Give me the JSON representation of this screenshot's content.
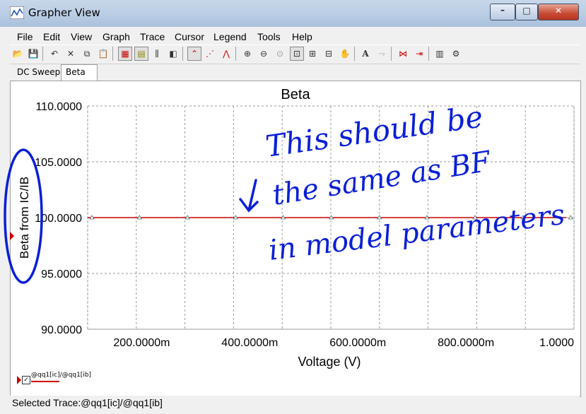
{
  "window": {
    "title": "Grapher View",
    "minimize": "–",
    "maximize": "□",
    "close": "✕"
  },
  "menu": [
    "File",
    "Edit",
    "View",
    "Graph",
    "Trace",
    "Cursor",
    "Legend",
    "Tools",
    "Help"
  ],
  "toolbar_icons": [
    "open-icon",
    "save-icon",
    "undo-icon",
    "cut-icon",
    "copy-icon",
    "paste-icon",
    "grid-icon",
    "fine-grid-icon",
    "legend-icon",
    "overlay-icon",
    "select-trace-icon",
    "show-points-icon",
    "marker-icon",
    "zoom-in-icon",
    "zoom-out-icon",
    "zoom-fit-icon",
    "zoom-region-icon",
    "zoom-x-icon",
    "zoom-y-icon",
    "pan-icon",
    "text-icon",
    "label-icon",
    "cursor-icon",
    "move-cursor-icon",
    "export-icon",
    "properties-icon"
  ],
  "tabs": [
    {
      "label": "DC Sweep",
      "active": false
    },
    {
      "label": "Beta",
      "active": true
    }
  ],
  "legend": {
    "trace_label": "@qq1[ic]/@qq1[ib]",
    "checkbox": "✓",
    "color": "#cc0000"
  },
  "status": {
    "text": "Selected Trace:@qq1[ic]/@qq1[ib]"
  },
  "annotation": {
    "lines": [
      "This should be",
      "the same as BF",
      "in model parameters"
    ],
    "color": "#0a1fd6"
  },
  "chart_data": {
    "type": "line",
    "title": "Beta",
    "xlabel": "Voltage (V)",
    "ylabel": "Beta from IC/IB",
    "xlim": [
      0.1,
      1.0
    ],
    "ylim": [
      90,
      110
    ],
    "x_ticks": [
      {
        "value": 0.2,
        "label": "200.0000m"
      },
      {
        "value": 0.4,
        "label": "400.0000m"
      },
      {
        "value": 0.6,
        "label": "600.0000m"
      },
      {
        "value": 0.8,
        "label": "800.0000m"
      },
      {
        "value": 1.0,
        "label": "1.0000"
      }
    ],
    "y_ticks": [
      {
        "value": 110,
        "label": "110.0000"
      },
      {
        "value": 105,
        "label": "105.0000"
      },
      {
        "value": 100,
        "label": "100.0000"
      },
      {
        "value": 95,
        "label": "95.0000"
      },
      {
        "value": 90,
        "label": "90.0000"
      }
    ],
    "grid": true,
    "series": [
      {
        "name": "@qq1[ic]/@qq1[ib]",
        "color": "#cc0000",
        "x": [
          0.1,
          0.188,
          0.277,
          0.366,
          0.454,
          0.543,
          0.632,
          0.72,
          0.809,
          0.898,
          0.986
        ],
        "y": [
          100,
          100,
          100,
          100,
          100,
          100,
          100,
          100,
          100,
          100,
          100
        ]
      }
    ]
  }
}
